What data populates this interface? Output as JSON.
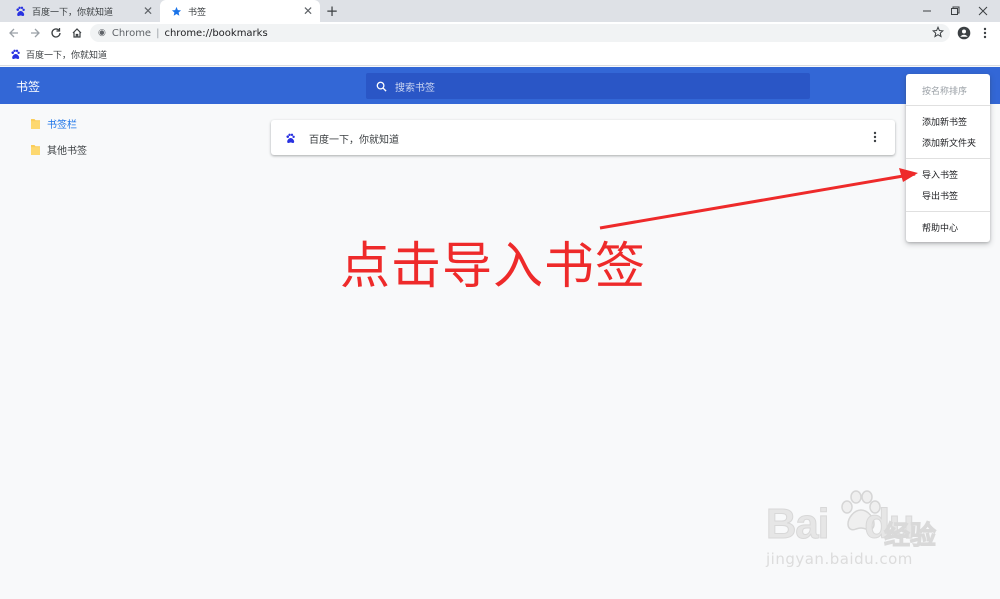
{
  "browser": {
    "tabs": [
      {
        "title": "百度一下，你就知道",
        "icon": "baidu-paw-icon",
        "active": false
      },
      {
        "title": "书签",
        "icon": "star-icon",
        "active": true
      }
    ],
    "new_tab_label": "+",
    "address": {
      "scheme_label": "Chrome",
      "url": "chrome://bookmarks"
    },
    "bookmarks_bar": [
      {
        "title": "百度一下，你就知道",
        "icon": "baidu-paw-icon"
      }
    ]
  },
  "bookmarks_page": {
    "title": "书签",
    "search_placeholder": "搜索书签",
    "sidebar": [
      {
        "label": "书签栏",
        "selected": true,
        "icon": "folder-icon"
      },
      {
        "label": "其他书签",
        "selected": false,
        "icon": "folder-icon"
      }
    ],
    "list": [
      {
        "title": "百度一下，你就知道",
        "icon": "baidu-paw-icon"
      }
    ],
    "menu": {
      "items": [
        {
          "label": "按名称排序",
          "disabled": true
        },
        {
          "label": "添加新书签"
        },
        {
          "label": "添加新文件夹"
        },
        {
          "label": "导入书签"
        },
        {
          "label": "导出书签"
        },
        {
          "label": "帮助中心"
        }
      ]
    }
  },
  "annotation": {
    "text": "点击导入书签"
  },
  "watermark": {
    "brand": "Bai",
    "brand2": "du",
    "cn": "经验",
    "url": "jingyan.baidu.com"
  },
  "colors": {
    "accent": "#3367d6",
    "annotation": "#ee2a2a",
    "folder": "#fbcd5a"
  }
}
